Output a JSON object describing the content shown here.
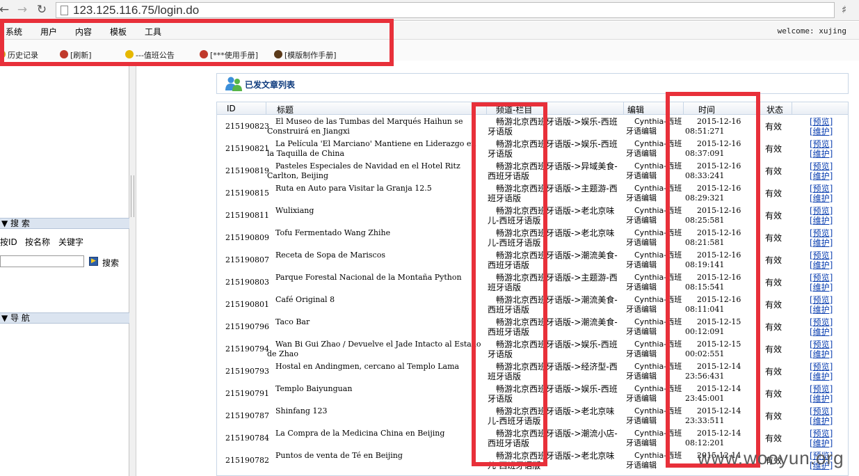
{
  "browser": {
    "url": "123.125.116.75/login.do"
  },
  "menubar": {
    "items": [
      "系统",
      "用户",
      "内容",
      "模板",
      "工具"
    ],
    "welcome": "welcome: xujing"
  },
  "bookmarks": [
    {
      "label": "历史记录",
      "color": "#d4a017"
    },
    {
      "label": "[刷新]",
      "color": "#c0392b"
    },
    {
      "label": "---值班公告",
      "color": "#e6b800"
    },
    {
      "label": "[***使用手册]",
      "color": "#c0392b"
    },
    {
      "label": "[模版制作手册]",
      "color": "#5b3a1a"
    }
  ],
  "left": {
    "search_header": "搜 索",
    "search_tabs": [
      "按ID",
      "按名称",
      "关键字"
    ],
    "search_input_value": "",
    "search_button": "搜索",
    "nav_header": "导 航"
  },
  "list": {
    "title": "已发文章列表",
    "columns": {
      "id": "ID",
      "title": "标题",
      "channel": "频道-栏目",
      "editor": "编辑",
      "time": "时间",
      "status": "状态"
    },
    "actions": {
      "preview": "[预览]",
      "maintain": "[维护]"
    },
    "rows": [
      {
        "id": "215190823",
        "title": "El Museo de las Tumbas del Marqués Haihun se Construirá en Jiangxi",
        "channel": "畅游北京西班牙语版->娱乐-西班牙语版",
        "editor": "Cynthia-西班牙语编辑",
        "time": "2015-12-16 08:51:271",
        "status": "有效"
      },
      {
        "id": "215190821",
        "title": "La Película 'El Marciano' Mantiene en Liderazgo en la Taquilla de China",
        "channel": "畅游北京西班牙语版->娱乐-西班牙语版",
        "editor": "Cynthia-西班牙语编辑",
        "time": "2015-12-16 08:37:091",
        "status": "有效"
      },
      {
        "id": "215190819",
        "title": "Pasteles Especiales de Navidad en el Hotel Ritz Carlton, Beijing",
        "channel": "畅游北京西班牙语版->异域美食-西班牙语版",
        "editor": "Cynthia-西班牙语编辑",
        "time": "2015-12-16 08:33:241",
        "status": "有效"
      },
      {
        "id": "215190815",
        "title": "Ruta en Auto para Visitar la Granja 12.5",
        "channel": "畅游北京西班牙语版->主题游-西班牙语版",
        "editor": "Cynthia-西班牙语编辑",
        "time": "2015-12-16 08:29:321",
        "status": "有效"
      },
      {
        "id": "215190811",
        "title": "Wulixiang",
        "channel": "畅游北京西班牙语版->老北京味儿-西班牙语版",
        "editor": "Cynthia-西班牙语编辑",
        "time": "2015-12-16 08:25:581",
        "status": "有效"
      },
      {
        "id": "215190809",
        "title": "Tofu Fermentado Wang Zhihe",
        "channel": "畅游北京西班牙语版->老北京味儿-西班牙语版",
        "editor": "Cynthia-西班牙语编辑",
        "time": "2015-12-16 08:21:581",
        "status": "有效"
      },
      {
        "id": "215190807",
        "title": "Receta de Sopa de Mariscos",
        "channel": "畅游北京西班牙语版->潮流美食-西班牙语版",
        "editor": "Cynthia-西班牙语编辑",
        "time": "2015-12-16 08:19:141",
        "status": "有效"
      },
      {
        "id": "215190803",
        "title": "Parque Forestal Nacional de la Montaña Python",
        "channel": "畅游北京西班牙语版->主题游-西班牙语版",
        "editor": "Cynthia-西班牙语编辑",
        "time": "2015-12-16 08:15:541",
        "status": "有效"
      },
      {
        "id": "215190801",
        "title": "Café Original 8",
        "channel": "畅游北京西班牙语版->潮流美食-西班牙语版",
        "editor": "Cynthia-西班牙语编辑",
        "time": "2015-12-16 08:11:041",
        "status": "有效"
      },
      {
        "id": "215190796",
        "title": "Taco Bar",
        "channel": "畅游北京西班牙语版->潮流美食-西班牙语版",
        "editor": "Cynthia-西班牙语编辑",
        "time": "2015-12-15 00:12:091",
        "status": "有效"
      },
      {
        "id": "215190794",
        "title": "Wan Bi Gui Zhao / Devuelve el Jade Intacto al Estado de Zhao",
        "channel": "畅游北京西班牙语版->娱乐-西班牙语版",
        "editor": "Cynthia-西班牙语编辑",
        "time": "2015-12-15 00:02:551",
        "status": "有效"
      },
      {
        "id": "215190793",
        "title": "Hostal en Andingmen, cercano al Templo Lama",
        "channel": "畅游北京西班牙语版->经济型-西班牙语版",
        "editor": "Cynthia-西班牙语编辑",
        "time": "2015-12-14 23:56:431",
        "status": "有效"
      },
      {
        "id": "215190791",
        "title": "Templo Baiyunguan",
        "channel": "畅游北京西班牙语版->娱乐-西班牙语版",
        "editor": "Cynthia-西班牙语编辑",
        "time": "2015-12-14 23:45:001",
        "status": "有效"
      },
      {
        "id": "215190787",
        "title": "Shinfang 123",
        "channel": "畅游北京西班牙语版->老北京味儿-西班牙语版",
        "editor": "Cynthia-西班牙语编辑",
        "time": "2015-12-14 23:33:511",
        "status": "有效"
      },
      {
        "id": "215190784",
        "title": "La Compra de la Medicina China en Beijing",
        "channel": "畅游北京西班牙语版->潮流小店-西班牙语版",
        "editor": "Cynthia-西班牙语编辑",
        "time": "2015-12-14 08:12:201",
        "status": "有效"
      },
      {
        "id": "215190782",
        "title": "Puntos de venta de Té en Beijing",
        "channel": "畅游北京西班牙语版->老北京味儿-西班牙语版",
        "editor": "Cynthia-西班牙语编辑",
        "time": "2015-12-14",
        "status": "有效"
      }
    ]
  },
  "watermark": "www.wooyun.org",
  "colors": {
    "annotation_red": "#e8303a",
    "link_blue": "#0b3fb0",
    "panel_header": "#dbe4f0"
  }
}
